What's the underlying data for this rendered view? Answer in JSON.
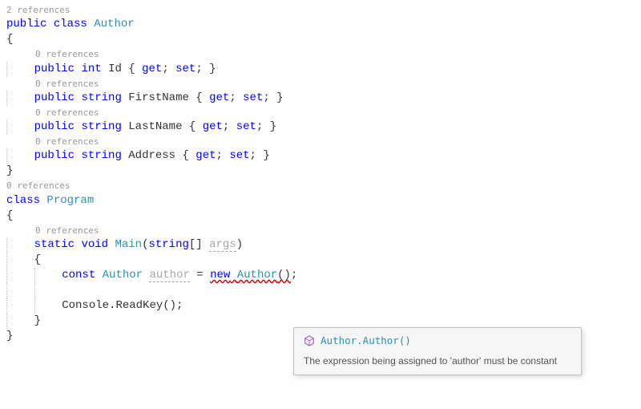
{
  "codelens": {
    "author_class": "2 references",
    "zero": "0 references"
  },
  "keywords": {
    "public": "public",
    "class": "class",
    "int": "int",
    "string": "string",
    "get": "get",
    "set": "set",
    "static": "static",
    "void": "void",
    "const": "const",
    "new": "new"
  },
  "types": {
    "Author": "Author",
    "Program": "Program",
    "Main": "Main"
  },
  "identifiers": {
    "Id": "Id",
    "FirstName": "FirstName",
    "LastName": "LastName",
    "Address": "Address",
    "args": "args",
    "author": "author",
    "Console": "Console",
    "ReadKey": "ReadKey"
  },
  "punct": {
    "brace_open": "{",
    "brace_close": "}",
    "accessor": "{ ",
    "accessor_mid": "; ",
    "accessor_end": "; }",
    "paren_open": "(",
    "paren_close": ")",
    "parens": "()",
    "brackets": "[]",
    "semi": ";",
    "space": " ",
    "equals": " = ",
    "dot": ".",
    "ctor_end": "();"
  },
  "tooltip": {
    "signature": "Author.Author()",
    "message": "The expression being assigned to 'author' must be constant"
  }
}
